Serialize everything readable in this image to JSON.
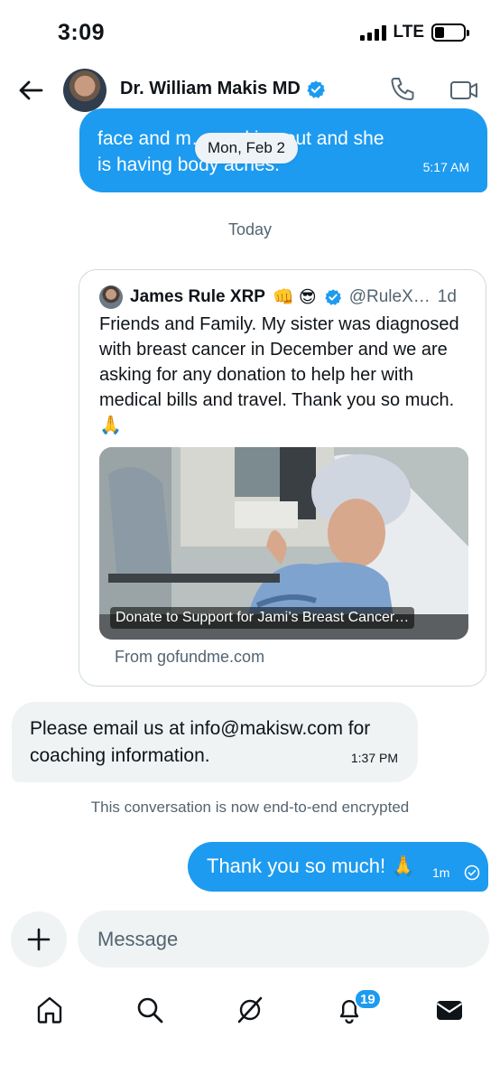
{
  "status_bar": {
    "time": "3:09",
    "network": "LTE",
    "signal_bars": 4,
    "battery_level": 0.25
  },
  "header": {
    "contact_name": "Dr. William Makis MD",
    "verified": true,
    "back_icon": "arrow-left-icon",
    "call_icon": "phone-icon",
    "video_icon": "video-camera-icon"
  },
  "conversation": {
    "sent_top": {
      "line1": "face and m… …aking out and she",
      "line2": "is having body aches.",
      "time": "5:17 AM"
    },
    "date_pill": "Mon, Feb 2",
    "today_label": "Today",
    "shared_tweet": {
      "author": "James Rule XRP",
      "author_emoji": "👊 😎",
      "handle": "@RuleX…",
      "age": "1d",
      "text": "Friends and Family. My sister was diagnosed with breast cancer in December and we are asking for any donation to help her with medical bills and travel. Thank you so much. 🙏",
      "media_caption": "Donate to Support for Jami’s Breast Cancer…",
      "source": "From gofundme.com"
    },
    "received": {
      "line1": "Please email us at info@makisw.com for",
      "line2": "coaching information.",
      "time": "1:37 PM"
    },
    "encrypted_note": "This conversation is now end-to-end encrypted",
    "sent_last": {
      "text": "Thank you so much! 🙏",
      "time": "1m"
    }
  },
  "composer": {
    "placeholder": "Message",
    "add_icon": "plus-icon"
  },
  "bottom_nav": {
    "items": [
      "home-icon",
      "search-icon",
      "grok-icon",
      "notifications-icon",
      "messages-icon"
    ],
    "notifications_badge": "19"
  },
  "colors": {
    "accent": "#1d9bf0",
    "received_bubble": "#eff3f4",
    "secondary_text": "#536471"
  }
}
